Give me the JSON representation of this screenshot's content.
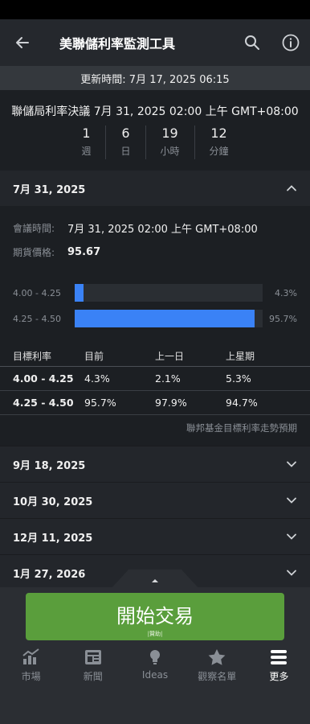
{
  "app": {
    "title": "美聯儲利率監測工具"
  },
  "updated": "更新時間: 7月 17, 2025 06:15",
  "decision": "聯儲局利率決議 7月 31, 2025 02:00 上午 GMT+08:00",
  "countdown": [
    {
      "value": "1",
      "unit": "週"
    },
    {
      "value": "6",
      "unit": "日"
    },
    {
      "value": "19",
      "unit": "小時"
    },
    {
      "value": "12",
      "unit": "分鐘"
    }
  ],
  "expanded_meeting": {
    "date": "7月 31, 2025",
    "meeting_time_label": "會議時間:",
    "meeting_time": "7月 31, 2025 02:00 上午 GMT+08:00",
    "futures_label": "期貨價格:",
    "futures_price": "95.67",
    "bars": [
      {
        "range": "4.00 - 4.25",
        "percent": 4.3,
        "percent_label": "4.3%"
      },
      {
        "range": "4.25 - 4.50",
        "percent": 95.7,
        "percent_label": "95.7%"
      }
    ],
    "table": {
      "headers": [
        "目標利率",
        "目前",
        "上一日",
        "上星期"
      ],
      "rows": [
        [
          "4.00 - 4.25",
          "4.3%",
          "2.1%",
          "5.3%"
        ],
        [
          "4.25 - 4.50",
          "95.7%",
          "97.9%",
          "94.7%"
        ]
      ]
    },
    "footnote": "聯邦基金目標利率走勢預期"
  },
  "collapsed_meetings": [
    "9月 18, 2025",
    "10月 30, 2025",
    "12月 11, 2025",
    "1月 27, 2026"
  ],
  "trade_button": {
    "label": "開始交易",
    "sub": "|贊助|"
  },
  "tabs": [
    {
      "label": "市場",
      "icon": "chart-icon",
      "active": false
    },
    {
      "label": "新聞",
      "icon": "news-icon",
      "active": false
    },
    {
      "label": "Ideas",
      "icon": "lightbulb-icon",
      "active": false
    },
    {
      "label": "觀察名單",
      "icon": "star-icon",
      "active": false
    },
    {
      "label": "更多",
      "icon": "menu-icon",
      "active": true
    }
  ],
  "colors": {
    "accent_bar": "#3a82f6",
    "trade_button": "#5a9e3c"
  }
}
